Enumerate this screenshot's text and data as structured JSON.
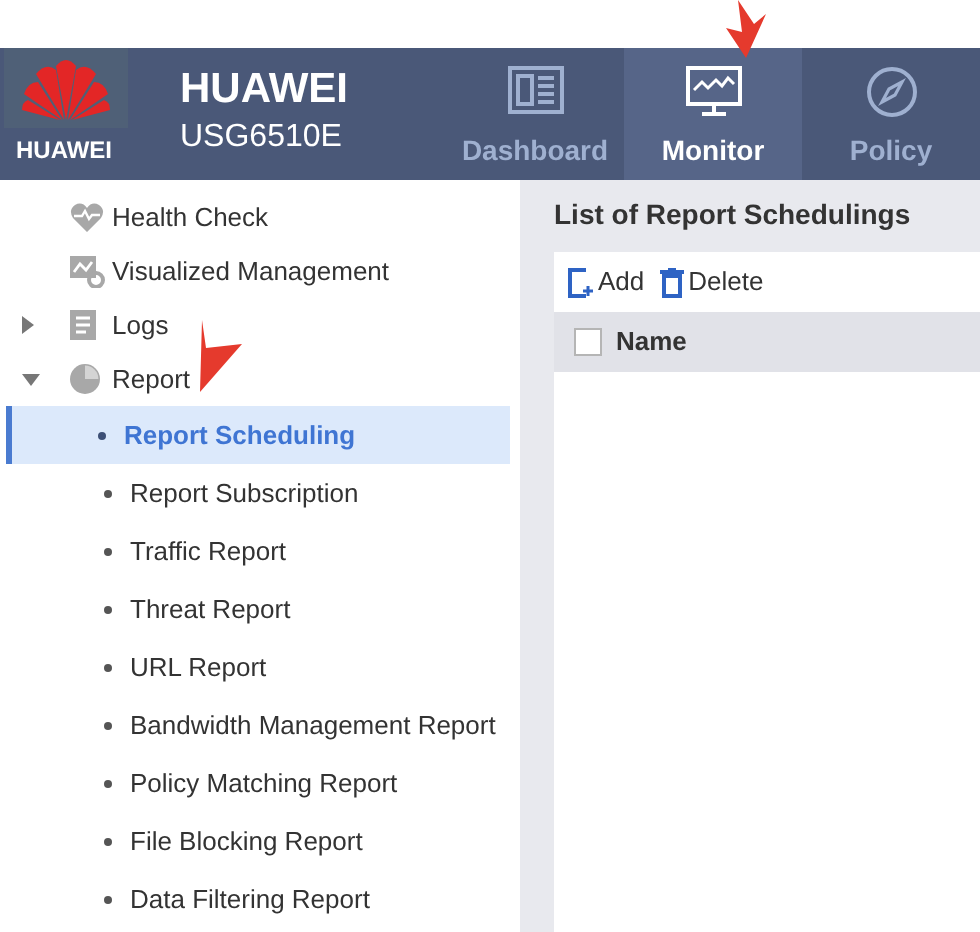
{
  "header": {
    "logo_text": "HUAWEI",
    "brand": "HUAWEI",
    "model": "USG6510E"
  },
  "tabs": [
    {
      "label": "Dashboard",
      "kind": "dashboard",
      "selected": false
    },
    {
      "label": "Monitor",
      "kind": "monitor",
      "selected": true
    },
    {
      "label": "Policy",
      "kind": "policy",
      "selected": false
    }
  ],
  "sidebar": {
    "items": [
      {
        "label": "Health Check",
        "kind": "health"
      },
      {
        "label": "Visualized Management",
        "kind": "visual"
      },
      {
        "label": "Logs",
        "kind": "logs",
        "expanded": false
      },
      {
        "label": "Report",
        "kind": "report",
        "expanded": true,
        "children": [
          {
            "label": "Report Scheduling",
            "selected": true
          },
          {
            "label": "Report Subscription",
            "selected": false
          },
          {
            "label": "Traffic Report",
            "selected": false
          },
          {
            "label": "Threat Report",
            "selected": false
          },
          {
            "label": "URL Report",
            "selected": false
          },
          {
            "label": "Bandwidth Management Report",
            "selected": false
          },
          {
            "label": "Policy Matching Report",
            "selected": false
          },
          {
            "label": "File Blocking Report",
            "selected": false
          },
          {
            "label": "Data Filtering Report",
            "selected": false
          }
        ]
      }
    ]
  },
  "panel": {
    "title": "List of Report Schedulings",
    "toolbar": [
      {
        "label": "Add",
        "kind": "add"
      },
      {
        "label": "Delete",
        "kind": "delete"
      }
    ],
    "table": {
      "columns": [
        {
          "label": "Name",
          "checked": false
        }
      ]
    }
  }
}
